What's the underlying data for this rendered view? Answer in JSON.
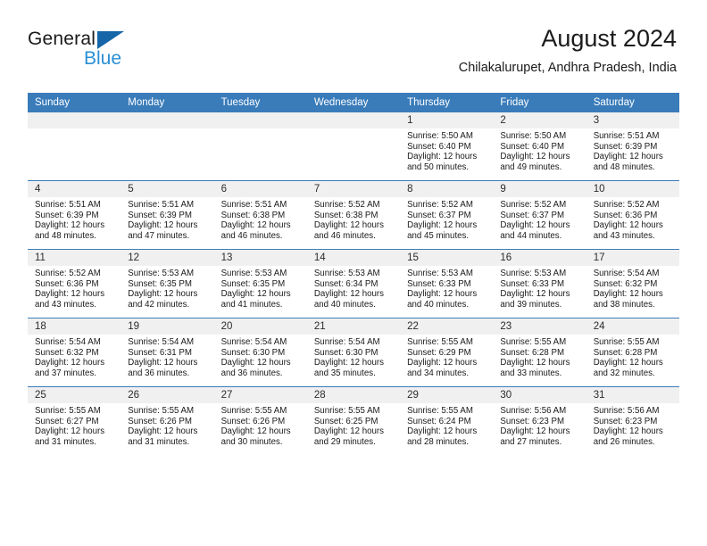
{
  "brand": {
    "word_one": "General",
    "word_two": "Blue",
    "triangle_icon": "triangle-logo-icon"
  },
  "header": {
    "title": "August 2024",
    "subtitle": "Chilakalurupet, Andhra Pradesh, India"
  },
  "colors": {
    "header_blue": "#3a7cba",
    "brand_dark": "#1a1a1a",
    "brand_blue": "#2a8fd4",
    "daynum_bg": "#f0f0f0"
  },
  "weekday_headers": [
    "Sunday",
    "Monday",
    "Tuesday",
    "Wednesday",
    "Thursday",
    "Friday",
    "Saturday"
  ],
  "labels": {
    "sunrise_prefix": "Sunrise:",
    "sunset_prefix": "Sunset:",
    "daylight_prefix": "Daylight:"
  },
  "weeks": [
    [
      {
        "day": "",
        "l1": "",
        "l2": "",
        "l3": "",
        "l4": ""
      },
      {
        "day": "",
        "l1": "",
        "l2": "",
        "l3": "",
        "l4": ""
      },
      {
        "day": "",
        "l1": "",
        "l2": "",
        "l3": "",
        "l4": ""
      },
      {
        "day": "",
        "l1": "",
        "l2": "",
        "l3": "",
        "l4": ""
      },
      {
        "day": "1",
        "l1": "Sunrise: 5:50 AM",
        "l2": "Sunset: 6:40 PM",
        "l3": "Daylight: 12 hours",
        "l4": "and 50 minutes."
      },
      {
        "day": "2",
        "l1": "Sunrise: 5:50 AM",
        "l2": "Sunset: 6:40 PM",
        "l3": "Daylight: 12 hours",
        "l4": "and 49 minutes."
      },
      {
        "day": "3",
        "l1": "Sunrise: 5:51 AM",
        "l2": "Sunset: 6:39 PM",
        "l3": "Daylight: 12 hours",
        "l4": "and 48 minutes."
      }
    ],
    [
      {
        "day": "4",
        "l1": "Sunrise: 5:51 AM",
        "l2": "Sunset: 6:39 PM",
        "l3": "Daylight: 12 hours",
        "l4": "and 48 minutes."
      },
      {
        "day": "5",
        "l1": "Sunrise: 5:51 AM",
        "l2": "Sunset: 6:39 PM",
        "l3": "Daylight: 12 hours",
        "l4": "and 47 minutes."
      },
      {
        "day": "6",
        "l1": "Sunrise: 5:51 AM",
        "l2": "Sunset: 6:38 PM",
        "l3": "Daylight: 12 hours",
        "l4": "and 46 minutes."
      },
      {
        "day": "7",
        "l1": "Sunrise: 5:52 AM",
        "l2": "Sunset: 6:38 PM",
        "l3": "Daylight: 12 hours",
        "l4": "and 46 minutes."
      },
      {
        "day": "8",
        "l1": "Sunrise: 5:52 AM",
        "l2": "Sunset: 6:37 PM",
        "l3": "Daylight: 12 hours",
        "l4": "and 45 minutes."
      },
      {
        "day": "9",
        "l1": "Sunrise: 5:52 AM",
        "l2": "Sunset: 6:37 PM",
        "l3": "Daylight: 12 hours",
        "l4": "and 44 minutes."
      },
      {
        "day": "10",
        "l1": "Sunrise: 5:52 AM",
        "l2": "Sunset: 6:36 PM",
        "l3": "Daylight: 12 hours",
        "l4": "and 43 minutes."
      }
    ],
    [
      {
        "day": "11",
        "l1": "Sunrise: 5:52 AM",
        "l2": "Sunset: 6:36 PM",
        "l3": "Daylight: 12 hours",
        "l4": "and 43 minutes."
      },
      {
        "day": "12",
        "l1": "Sunrise: 5:53 AM",
        "l2": "Sunset: 6:35 PM",
        "l3": "Daylight: 12 hours",
        "l4": "and 42 minutes."
      },
      {
        "day": "13",
        "l1": "Sunrise: 5:53 AM",
        "l2": "Sunset: 6:35 PM",
        "l3": "Daylight: 12 hours",
        "l4": "and 41 minutes."
      },
      {
        "day": "14",
        "l1": "Sunrise: 5:53 AM",
        "l2": "Sunset: 6:34 PM",
        "l3": "Daylight: 12 hours",
        "l4": "and 40 minutes."
      },
      {
        "day": "15",
        "l1": "Sunrise: 5:53 AM",
        "l2": "Sunset: 6:33 PM",
        "l3": "Daylight: 12 hours",
        "l4": "and 40 minutes."
      },
      {
        "day": "16",
        "l1": "Sunrise: 5:53 AM",
        "l2": "Sunset: 6:33 PM",
        "l3": "Daylight: 12 hours",
        "l4": "and 39 minutes."
      },
      {
        "day": "17",
        "l1": "Sunrise: 5:54 AM",
        "l2": "Sunset: 6:32 PM",
        "l3": "Daylight: 12 hours",
        "l4": "and 38 minutes."
      }
    ],
    [
      {
        "day": "18",
        "l1": "Sunrise: 5:54 AM",
        "l2": "Sunset: 6:32 PM",
        "l3": "Daylight: 12 hours",
        "l4": "and 37 minutes."
      },
      {
        "day": "19",
        "l1": "Sunrise: 5:54 AM",
        "l2": "Sunset: 6:31 PM",
        "l3": "Daylight: 12 hours",
        "l4": "and 36 minutes."
      },
      {
        "day": "20",
        "l1": "Sunrise: 5:54 AM",
        "l2": "Sunset: 6:30 PM",
        "l3": "Daylight: 12 hours",
        "l4": "and 36 minutes."
      },
      {
        "day": "21",
        "l1": "Sunrise: 5:54 AM",
        "l2": "Sunset: 6:30 PM",
        "l3": "Daylight: 12 hours",
        "l4": "and 35 minutes."
      },
      {
        "day": "22",
        "l1": "Sunrise: 5:55 AM",
        "l2": "Sunset: 6:29 PM",
        "l3": "Daylight: 12 hours",
        "l4": "and 34 minutes."
      },
      {
        "day": "23",
        "l1": "Sunrise: 5:55 AM",
        "l2": "Sunset: 6:28 PM",
        "l3": "Daylight: 12 hours",
        "l4": "and 33 minutes."
      },
      {
        "day": "24",
        "l1": "Sunrise: 5:55 AM",
        "l2": "Sunset: 6:28 PM",
        "l3": "Daylight: 12 hours",
        "l4": "and 32 minutes."
      }
    ],
    [
      {
        "day": "25",
        "l1": "Sunrise: 5:55 AM",
        "l2": "Sunset: 6:27 PM",
        "l3": "Daylight: 12 hours",
        "l4": "and 31 minutes."
      },
      {
        "day": "26",
        "l1": "Sunrise: 5:55 AM",
        "l2": "Sunset: 6:26 PM",
        "l3": "Daylight: 12 hours",
        "l4": "and 31 minutes."
      },
      {
        "day": "27",
        "l1": "Sunrise: 5:55 AM",
        "l2": "Sunset: 6:26 PM",
        "l3": "Daylight: 12 hours",
        "l4": "and 30 minutes."
      },
      {
        "day": "28",
        "l1": "Sunrise: 5:55 AM",
        "l2": "Sunset: 6:25 PM",
        "l3": "Daylight: 12 hours",
        "l4": "and 29 minutes."
      },
      {
        "day": "29",
        "l1": "Sunrise: 5:55 AM",
        "l2": "Sunset: 6:24 PM",
        "l3": "Daylight: 12 hours",
        "l4": "and 28 minutes."
      },
      {
        "day": "30",
        "l1": "Sunrise: 5:56 AM",
        "l2": "Sunset: 6:23 PM",
        "l3": "Daylight: 12 hours",
        "l4": "and 27 minutes."
      },
      {
        "day": "31",
        "l1": "Sunrise: 5:56 AM",
        "l2": "Sunset: 6:23 PM",
        "l3": "Daylight: 12 hours",
        "l4": "and 26 minutes."
      }
    ]
  ]
}
